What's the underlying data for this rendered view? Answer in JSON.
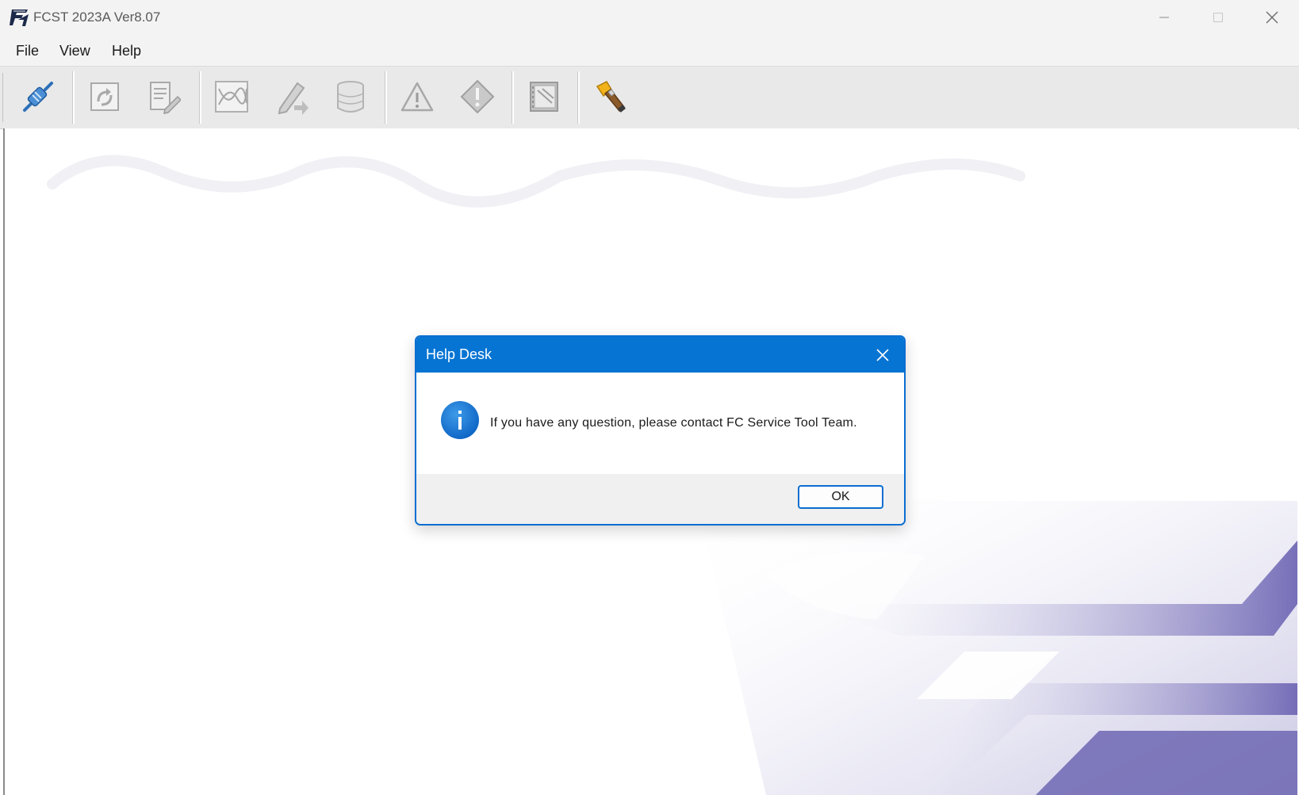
{
  "window": {
    "title": "FCST 2023A Ver8.07",
    "app_icon": "fcst-logo-icon",
    "controls": [
      "minimize-icon",
      "maximize-icon",
      "close-icon"
    ]
  },
  "menu": {
    "file": "File",
    "view": "View",
    "help": "Help"
  },
  "toolbar": {
    "buttons": [
      {
        "icon": "connect-plug-icon",
        "enabled": true
      },
      {
        "icon": "refresh-document-icon",
        "enabled": false
      },
      {
        "icon": "edit-document-icon",
        "enabled": false
      },
      {
        "icon": "curve-graph-icon",
        "enabled": false
      },
      {
        "icon": "pen-arrow-icon",
        "enabled": false
      },
      {
        "icon": "database-icon",
        "enabled": false
      },
      {
        "icon": "warning-triangle-icon",
        "enabled": false
      },
      {
        "icon": "alert-diamond-icon",
        "enabled": false
      },
      {
        "icon": "notebook-icon",
        "enabled": false
      },
      {
        "icon": "flashlight-icon",
        "enabled": true
      }
    ]
  },
  "dialog": {
    "title": "Help Desk",
    "icon": "info-icon",
    "message": "If you have any question, please contact FC Service Tool Team.",
    "ok_label": "OK"
  },
  "colors": {
    "dialog_accent": "#0674d3",
    "watermark": "#5a52a8"
  }
}
